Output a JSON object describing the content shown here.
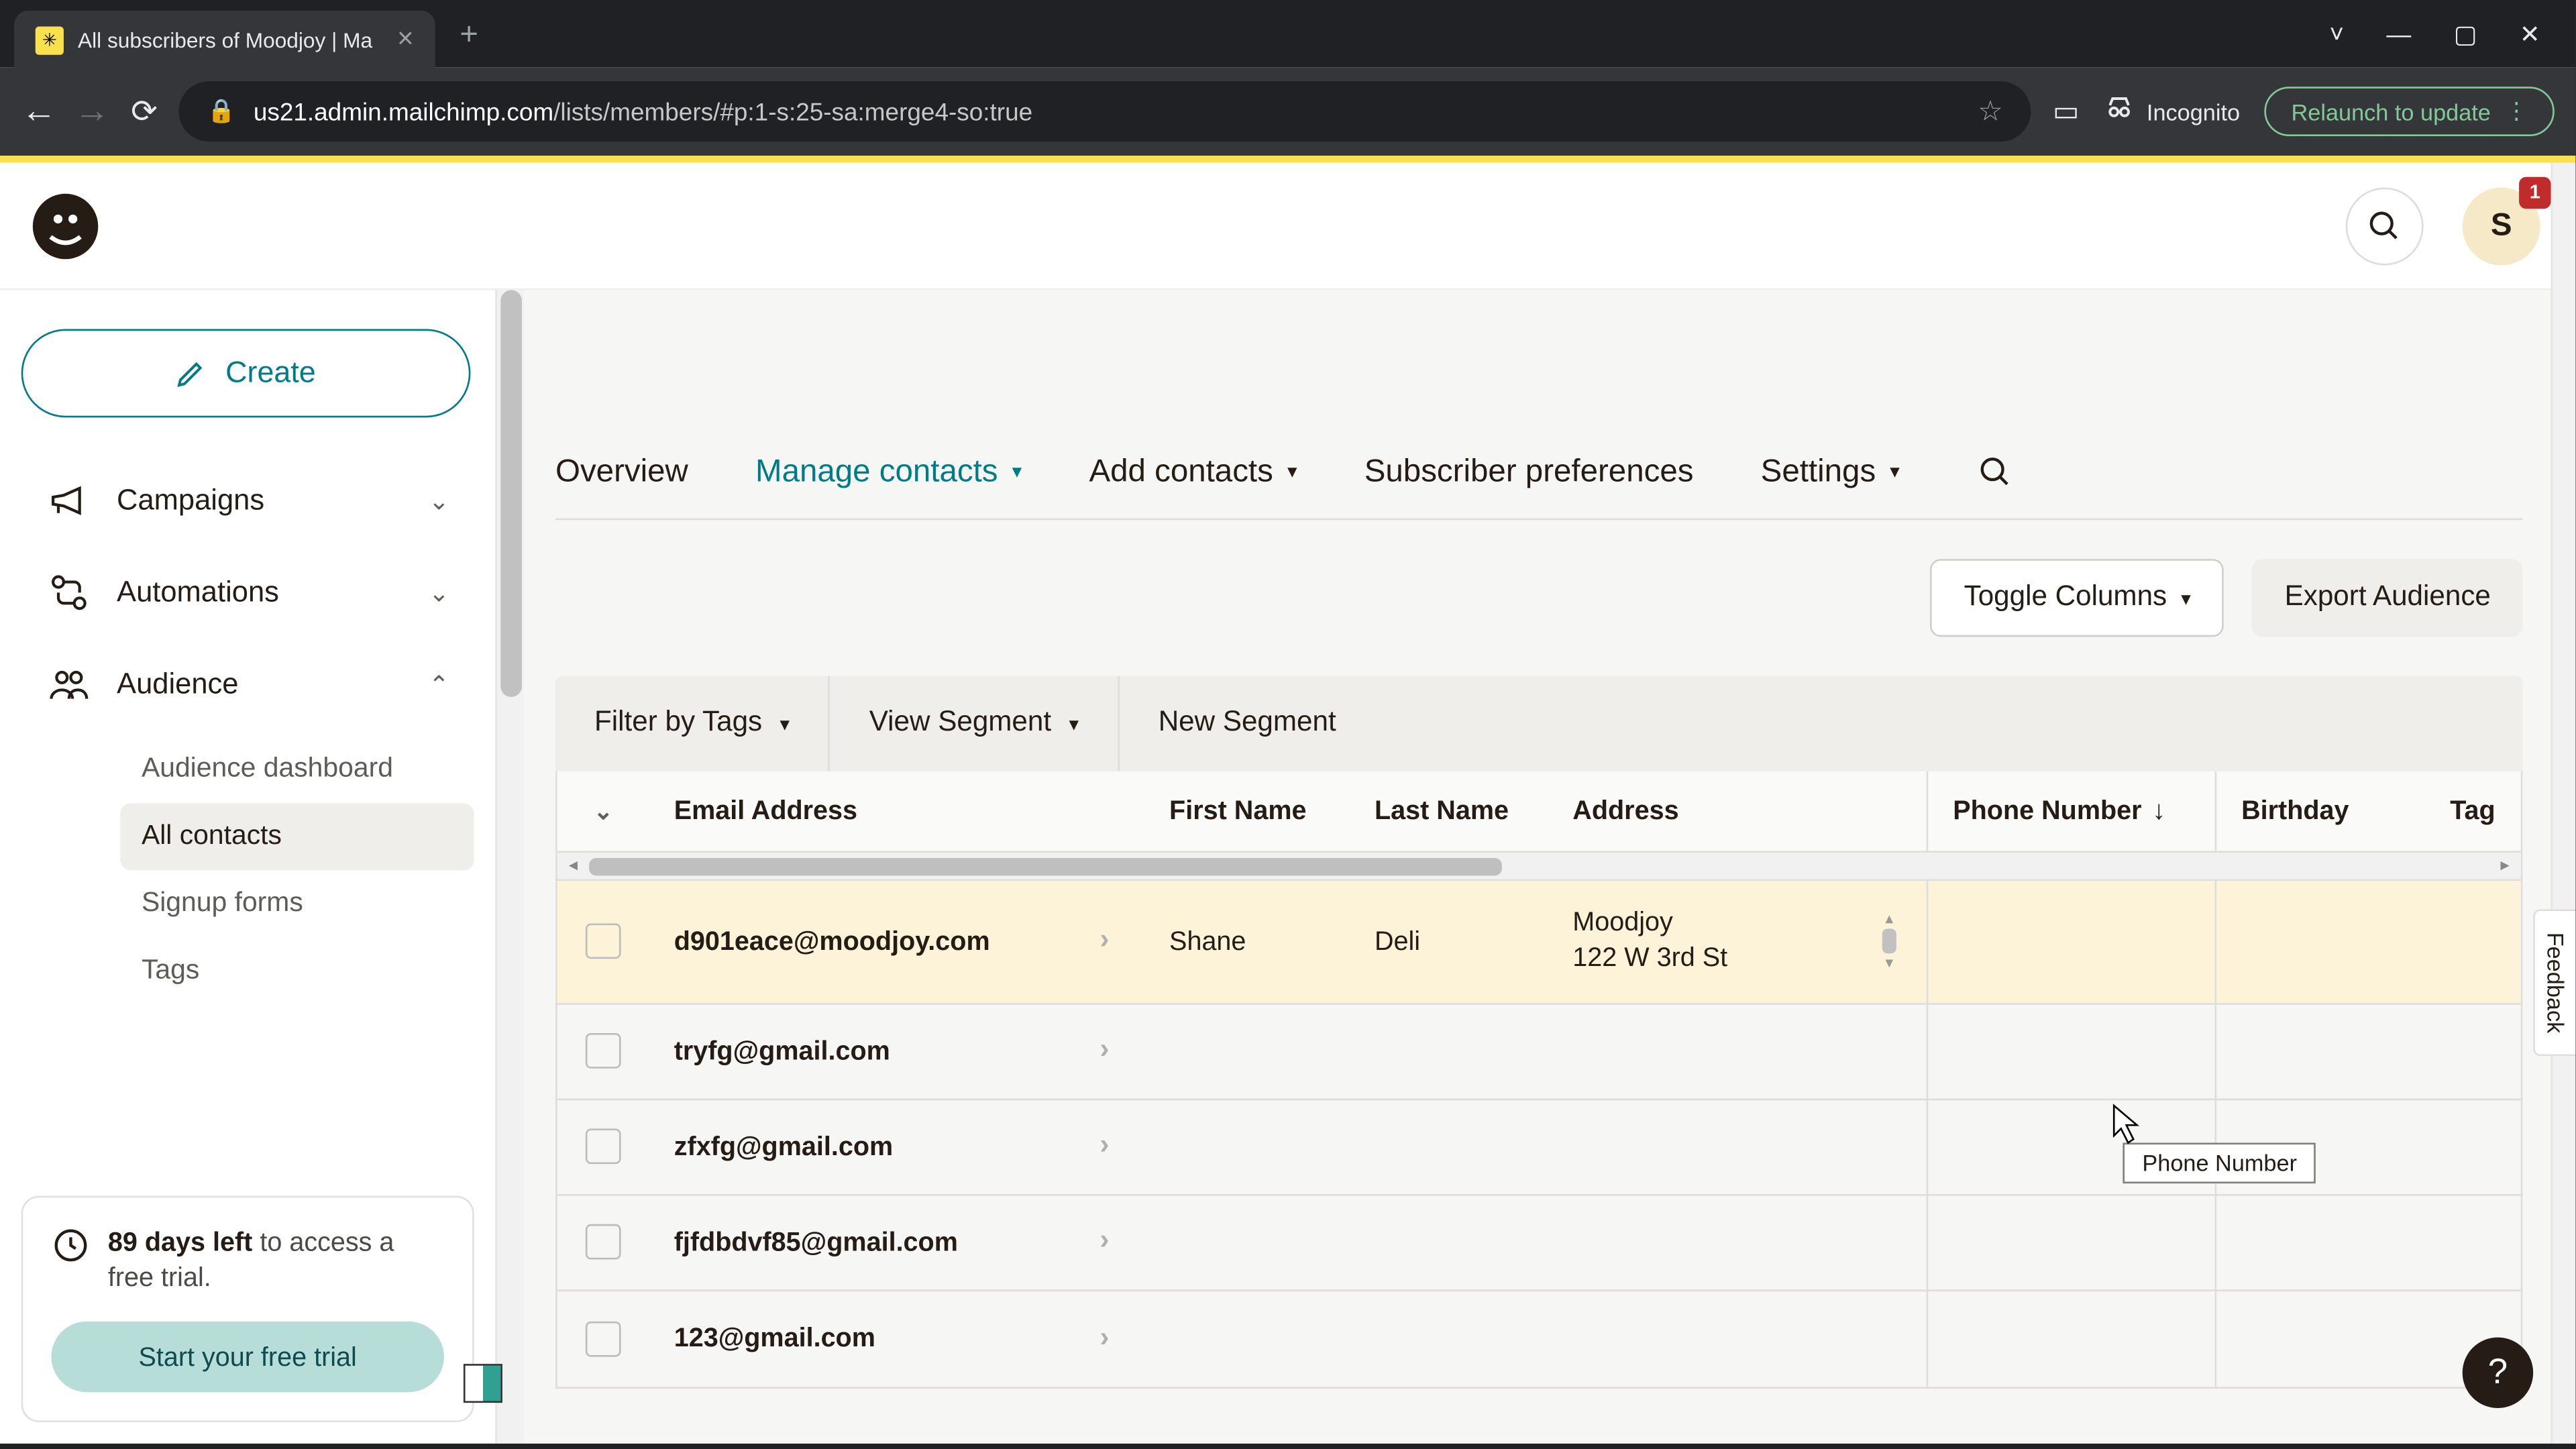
{
  "browser": {
    "tab_title": "All subscribers of Moodjoy | Ma",
    "url_domain": "us21.admin.mailchimp.com",
    "url_path": "/lists/members/#p:1-s:25-sa:merge4-so:true",
    "incognito_label": "Incognito",
    "relaunch_label": "Relaunch to update"
  },
  "header": {
    "avatar_initial": "S",
    "badge_count": "1"
  },
  "sidebar": {
    "create_label": "Create",
    "items": [
      {
        "label": "Campaigns",
        "expanded": false
      },
      {
        "label": "Automations",
        "expanded": false
      },
      {
        "label": "Audience",
        "expanded": true
      }
    ],
    "sub_items": [
      {
        "label": "Audience dashboard"
      },
      {
        "label": "All contacts"
      },
      {
        "label": "Signup forms"
      },
      {
        "label": "Tags"
      }
    ],
    "trial": {
      "days_bold": "89 days left",
      "days_rest": " to access a free trial.",
      "button": "Start your free trial"
    }
  },
  "tabs": {
    "overview": "Overview",
    "manage": "Manage contacts",
    "add": "Add contacts",
    "pref": "Subscriber preferences",
    "settings": "Settings"
  },
  "actions": {
    "toggle_columns": "Toggle Columns",
    "export": "Export Audience"
  },
  "filters": {
    "by_tags": "Filter by Tags",
    "view_segment": "View Segment",
    "new_segment": "New Segment"
  },
  "columns": {
    "email": "Email Address",
    "first_name": "First Name",
    "last_name": "Last Name",
    "address": "Address",
    "phone": "Phone Number",
    "birthday": "Birthday",
    "tag": "Tag"
  },
  "rows": [
    {
      "email": "d901eace@moodjoy.com",
      "first_name": "Shane",
      "last_name": "Deli",
      "address_line1": "Moodjoy",
      "address_line2": "122 W 3rd St",
      "phone": "",
      "birthday": "",
      "highlight": true
    },
    {
      "email": "tryfg@gmail.com"
    },
    {
      "email": "zfxfg@gmail.com"
    },
    {
      "email": "fjfdbdvf85@gmail.com"
    },
    {
      "email": "123@gmail.com"
    }
  ],
  "tooltip": "Phone Number",
  "feedback": "Feedback"
}
